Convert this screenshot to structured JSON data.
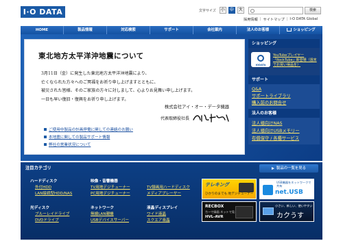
{
  "header": {
    "logo": "I·O DATA",
    "font_size_label": "文字サイズ",
    "font_sizes": [
      "小",
      "中",
      "大"
    ],
    "search_button": "検索",
    "links": [
      "採用情報",
      "サイトマップ",
      "I-O DATA Global"
    ]
  },
  "nav": {
    "items": [
      "HOME",
      "製品情報",
      "対応検索",
      "サポート",
      "会社案内",
      "法人のお客様",
      "ショッピング"
    ]
  },
  "notice": {
    "title": "東北地方太平洋沖地震について",
    "body": [
      "3月11日（金）に発生した東北地方太平洋沖地震により、",
      "亡くなられた方々へのご冥福をお祈り申し上げますとともに、",
      "被災された皆様、そのご家族の方々に対しまして、心よりお見舞い申し上げます。",
      "一日も早い復旧・復興をお祈り申し上げます。"
    ],
    "company": "株式会社アイ・オー・データ機器",
    "rep_title": "代表取締役社長",
    "links": [
      "ご使用中製品の計画停電に関しての連絡のお願い",
      "本地震に関しての製品サポート情報",
      "弊社の営業状況について"
    ]
  },
  "right": {
    "shopping_head": "ショッピング",
    "shop_icon_label": "IODATA",
    "shop_text": "YouTubeプレイヤー「RockTube」新登場（週末でお買い得品を）",
    "support_head": "サポート",
    "support_links": [
      "Q&A",
      "サポートライブラリ",
      "購入前のお問合せ"
    ],
    "business_head": "法人のお客様",
    "business_links": [
      "法人様向けNAS",
      "法人様向けUSBメモリー",
      "有償保守 / 各種サービス"
    ]
  },
  "categories": {
    "title": "注目カテゴリ",
    "all_button": "製品の一覧を見る",
    "groups": [
      {
        "head": "ハードディスク",
        "links": [
          "外付HDD",
          "LAN接続型HDD/NAS"
        ]
      },
      {
        "head": "映像・音響機器",
        "links": [
          "TV用地デジチューナー",
          "PC用地デジチューナー"
        ]
      },
      {
        "head": "",
        "links": [
          "TV録画用ハードディスク",
          "メディアプレーヤー"
        ]
      },
      {
        "head": "光ディスク",
        "links": [
          "ブルーレイドライブ",
          "DVDドライブ"
        ]
      },
      {
        "head": "ネットワーク",
        "links": [
          "無線LAN親機",
          "USBデバイスサーバー"
        ]
      },
      {
        "head": "液晶ディスプレイ",
        "links": [
          "ワイド液晶",
          "スクエア液晶"
        ]
      }
    ]
  },
  "banners": {
    "b1_title": "テレキング",
    "b1_sub": "ひかりのまでも 地デジチューナー",
    "b2_title": "USB機器をネットワークで共有",
    "b2_big": "net.USB",
    "b3_title": "RECBOX",
    "b3_sub": "カーで録画 ネットで見る",
    "b3_model": "HVL-AVR",
    "b4_title": "小さい、新しい、使いやすい",
    "b4_big": "カクうす"
  }
}
